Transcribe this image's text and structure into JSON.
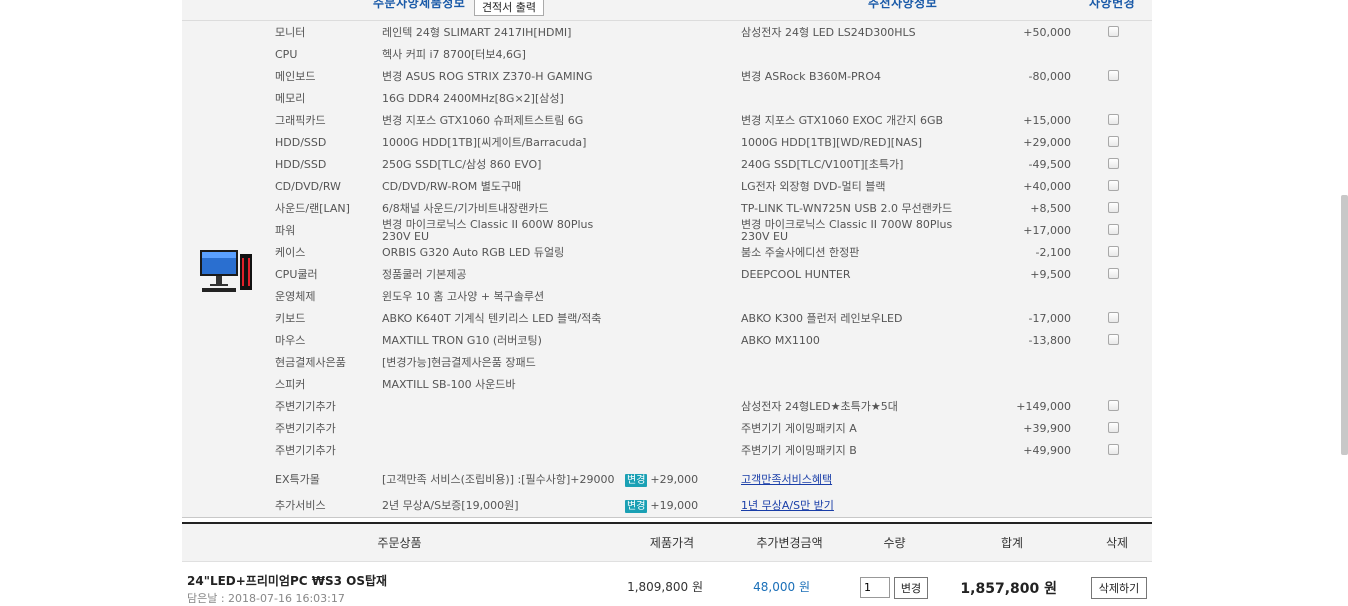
{
  "header": {
    "order_spec_label": "주문사양제품정보",
    "print_estimate_button": "견적서 출력",
    "recommended_label": "추천사양정보",
    "change_spec_label": "사양변경"
  },
  "spec_rows": [
    {
      "label": "모니터",
      "current": "레인텍 24형 SLIMART 2417IH[HDMI]",
      "recommended": "삼성전자 24형 LED LS24D300HLS",
      "price": "+50,000",
      "checkbox": true
    },
    {
      "label": "CPU",
      "current": "헥사 커피 i7 8700[터보4,6G]",
      "recommended": "",
      "price": "",
      "checkbox": false
    },
    {
      "label": "메인보드",
      "current": "변경 ASUS ROG STRIX Z370-H GAMING",
      "recommended": "변경 ASRock B360M-PRO4",
      "price": "-80,000",
      "checkbox": true
    },
    {
      "label": "메모리",
      "current": "16G DDR4 2400MHz[8G×2][삼성]",
      "recommended": "",
      "price": "",
      "checkbox": false
    },
    {
      "label": "그래픽카드",
      "current": "변경 지포스 GTX1060 슈퍼제트스트림 6G",
      "recommended": "변경 지포스 GTX1060 EXOC 개간지 6GB",
      "price": "+15,000",
      "checkbox": true
    },
    {
      "label": "HDD/SSD",
      "current": "1000G HDD[1TB][씨게이트/Barracuda]",
      "recommended": "1000G HDD[1TB][WD/RED][NAS]",
      "price": "+29,000",
      "checkbox": true
    },
    {
      "label": "HDD/SSD",
      "current": "250G SSD[TLC/삼성 860 EVO]",
      "recommended": "240G SSD[TLC/V100T][초특가]",
      "price": "-49,500",
      "checkbox": true
    },
    {
      "label": "CD/DVD/RW",
      "current": "CD/DVD/RW-ROM 별도구매",
      "recommended": "LG전자 외장형 DVD-멀티 블랙",
      "price": "+40,000",
      "checkbox": true
    },
    {
      "label": "사운드/랜[LAN]",
      "current": "6/8채널 사운드/기가비트내장랜카드",
      "recommended": "TP-LINK TL-WN725N USB 2.0 무선랜카드",
      "price": "+8,500",
      "checkbox": true
    },
    {
      "label": "파워",
      "current": "변경 마이크로닉스 Classic II 600W 80Plus 230V EU",
      "recommended": "변경 마이크로닉스 Classic II 700W 80Plus 230V EU",
      "price": "+17,000",
      "checkbox": true
    },
    {
      "label": "케이스",
      "current": "ORBIS G320 Auto RGB LED 듀얼링",
      "recommended": "붐소 주술사에디션 한정판",
      "price": "-2,100",
      "checkbox": true
    },
    {
      "label": "CPU쿨러",
      "current": "정품쿨러 기본제공",
      "recommended": "DEEPCOOL HUNTER",
      "price": "+9,500",
      "checkbox": true
    },
    {
      "label": "운영체제",
      "current": "윈도우 10 홈 고사양 + 복구솔루션",
      "recommended": "",
      "price": "",
      "checkbox": false
    },
    {
      "label": "키보드",
      "current": "ABKO K640T 기계식 텐키리스 LED 블랙/적축",
      "recommended": "ABKO K300 플런저 레인보우LED",
      "price": "-17,000",
      "checkbox": true
    },
    {
      "label": "마우스",
      "current": "MAXTILL TRON G10 (러버코팅)",
      "recommended": "ABKO MX1100",
      "price": "-13,800",
      "checkbox": true
    },
    {
      "label": "현금결제사은품",
      "current": "[변경가능]현금결제사은품 장패드",
      "recommended": "",
      "price": "",
      "checkbox": false
    },
    {
      "label": "스피커",
      "current": "MAXTILL SB-100 사운드바",
      "recommended": "",
      "price": "",
      "checkbox": false
    },
    {
      "label": "주변기기추가",
      "current": "",
      "recommended": "삼성전자 24형LED★초특가★5대",
      "price": "+149,000",
      "checkbox": true
    },
    {
      "label": "주변기기추가",
      "current": "",
      "recommended": "주변기기 게이밍패키지 A",
      "price": "+39,900",
      "checkbox": true
    },
    {
      "label": "주변기기추가",
      "current": "",
      "recommended": "주변기기 게이밍패키지 B",
      "price": "+49,900",
      "checkbox": true
    }
  ],
  "service_rows": [
    {
      "label": "EX특가몰",
      "current": "[고객만족 서비스(조립비용)] :[필수사항]+29000",
      "badge": "변경",
      "badge_price": "+29,000",
      "link": "고객만족서비스혜택"
    },
    {
      "label": "추가서비스",
      "current": "2년 무상A/S보증[19,000원]",
      "badge": "변경",
      "badge_price": "+19,000",
      "link": "1년 무상A/S만 받기"
    }
  ],
  "cart": {
    "headers": {
      "product": "주문상품",
      "price": "제품가격",
      "extra": "추가변경금액",
      "qty": "수량",
      "total": "합계",
      "delete": "삭제"
    },
    "item": {
      "name": "24\"LED+프리미엄PC ₩S3 OS탑재",
      "date": "담은날 : 2018-07-16 16:03:17",
      "price": "1,809,800 원",
      "extra": "48,000 원",
      "qty": "1",
      "qty_button": "변경",
      "total": "1,857,800 원",
      "delete_button": "삭제하기"
    }
  }
}
